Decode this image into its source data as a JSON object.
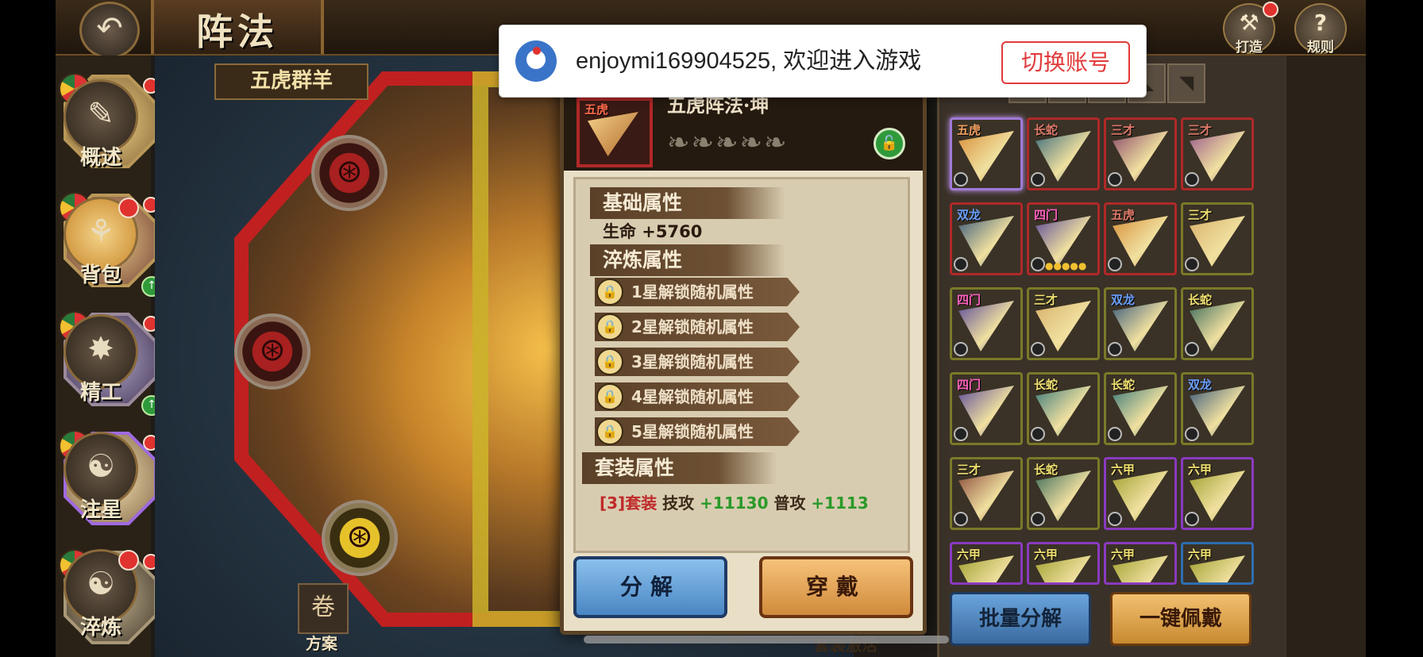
{
  "header": {
    "title": "阵法",
    "back_icon": "back-arrow-icon",
    "forge_label": "打造",
    "rules_label": "规则"
  },
  "toast": {
    "message": "enjoymi169904525, 欢迎进入游戏",
    "switch_label": "切换账号"
  },
  "formation": {
    "name_banner": "五虎群羊",
    "scheme_label": "方案",
    "set_activated_label": "套装激活"
  },
  "popup": {
    "item_tag": "五虎",
    "item_name": "五虎阵法·坤",
    "item_stars": "०००००",
    "basic_heading": "基础属性",
    "basic_value": "生命 +5760",
    "refine_heading": "淬炼属性",
    "unlock_rows": [
      "1星解锁随机属性",
      "2星解锁随机属性",
      "3星解锁随机属性",
      "4星解锁随机属性",
      "5星解锁随机属性"
    ],
    "set_heading": "套装属性",
    "set_line": {
      "tag": "[3]套装",
      "a": "技攻",
      "av": "+11130",
      "b": "普攻",
      "bv": "+1113"
    },
    "decompose_label": "分解",
    "equip_label": "穿戴"
  },
  "pieces": [
    {
      "name": "五虎",
      "color": "#f0a060"
    },
    {
      "name": "长蛇",
      "color": "#e07a6a"
    },
    {
      "name": "三才",
      "color": "#e07a6a"
    },
    {
      "name": "三才",
      "color": "#e07a6a"
    },
    {
      "name": "双龙",
      "color": "#6aa0ff"
    },
    {
      "name": "四门",
      "color": "#ff60c0"
    },
    {
      "name": "五虎",
      "color": "#e07a6a"
    },
    {
      "name": "三才",
      "color": "#f0e070"
    },
    {
      "name": "四门",
      "color": "#ff60c0"
    },
    {
      "name": "三才",
      "color": "#f0e070"
    },
    {
      "name": "双龙",
      "color": "#6aa0ff"
    },
    {
      "name": "长蛇",
      "color": "#f0e070"
    },
    {
      "name": "四门",
      "color": "#ff60c0"
    },
    {
      "name": "长蛇",
      "color": "#f0e070"
    },
    {
      "name": "长蛇",
      "color": "#f0e070"
    },
    {
      "name": "双龙",
      "color": "#6aa0ff"
    },
    {
      "name": "三才",
      "color": "#f0e070"
    },
    {
      "name": "长蛇",
      "color": "#f0e070"
    },
    {
      "name": "六甲",
      "color": "#f0e070"
    },
    {
      "name": "六甲",
      "color": "#f0e070"
    },
    {
      "name": "六甲",
      "color": "#f0e070"
    },
    {
      "name": "六甲",
      "color": "#f0e070"
    },
    {
      "name": "六甲",
      "color": "#f0e070"
    },
    {
      "name": "六甲",
      "color": "#f0e070"
    }
  ],
  "right_panel": {
    "batch_decompose_label": "批量分解",
    "one_key_equip_label": "一键佩戴"
  },
  "sidebar": {
    "overview": "概述",
    "backpack": "背包",
    "craft": "精工",
    "inject_star": "注星",
    "refine": "淬炼"
  }
}
